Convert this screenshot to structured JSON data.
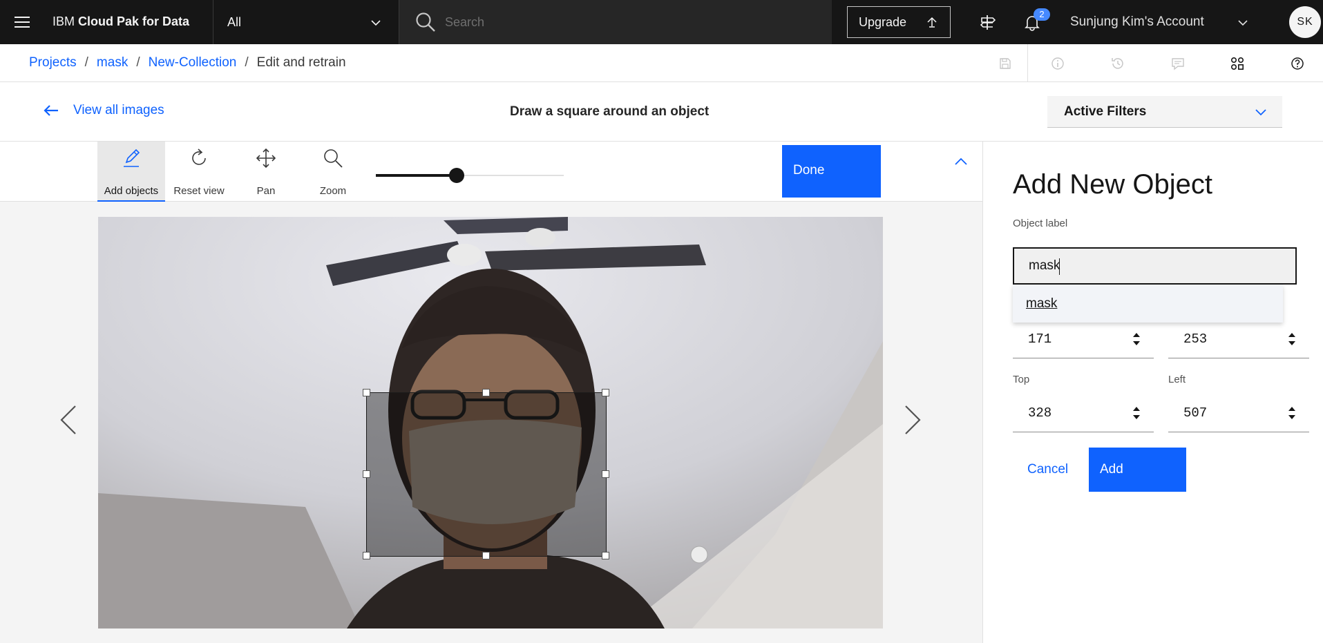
{
  "topbar": {
    "brand_prefix": "IBM ",
    "brand_name": "Cloud Pak for Data",
    "scope": "All",
    "search_placeholder": "Search",
    "upgrade_label": "Upgrade",
    "notification_count": "2",
    "account_name": "Sunjung Kim's Account",
    "avatar_initials": "SK"
  },
  "breadcrumb": {
    "items": [
      "Projects",
      "mask",
      "New-Collection"
    ],
    "current": "Edit and retrain",
    "separator": "/"
  },
  "header": {
    "back_label": "View all images",
    "instruction": "Draw a square around an object",
    "filters_label": "Active Filters"
  },
  "toolbar": {
    "tools": [
      "Add objects",
      "Reset view",
      "Pan",
      "Zoom"
    ],
    "active_tool": "Add objects",
    "zoom_level": 0.43,
    "done_label": "Done"
  },
  "panel": {
    "title": "Add New Object",
    "object_label_caption": "Object label",
    "object_label_value": "mask",
    "suggestion": "mask",
    "width_value": "171",
    "height_value": "253",
    "top_label": "Top",
    "top_value": "328",
    "left_label": "Left",
    "left_value": "507",
    "cancel_label": "Cancel",
    "add_label": "Add"
  },
  "colors": {
    "accent": "#0f62fe",
    "topbar_bg": "#161616",
    "badge": "#4589ff"
  },
  "icons": [
    "menu-icon",
    "chevron-down-icon",
    "search-icon",
    "upgrade-arrow-icon",
    "signpost-icon",
    "notification-bell-icon",
    "arrow-left-icon",
    "save-icon",
    "info-icon",
    "history-icon",
    "comment-icon",
    "settings-adjust-icon",
    "help-icon",
    "pencil-icon",
    "reset-icon",
    "move-icon",
    "zoom-icon",
    "chevron-up-icon",
    "chevron-left-icon",
    "chevron-right-icon",
    "spinner-arrows-icon"
  ]
}
